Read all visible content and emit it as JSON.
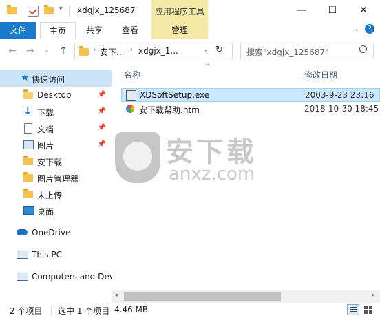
{
  "window": {
    "title": "xdgjx_125687",
    "contextual_tab_label": "应用程序工具",
    "controls": {
      "minimize": "—",
      "maximize": "☐",
      "close": "✕"
    }
  },
  "ribbon": {
    "tabs": [
      {
        "label": "文件"
      },
      {
        "label": "主页"
      },
      {
        "label": "共享"
      },
      {
        "label": "查看"
      },
      {
        "label": "管理"
      }
    ]
  },
  "address": {
    "segments": [
      "安下...",
      "xdgjx_1..."
    ],
    "search_placeholder": "搜索\"xdgjx_125687\""
  },
  "nav": {
    "quick_access": "快速访问",
    "items": [
      {
        "label": "Desktop",
        "icon": "folder-blue-icon",
        "pinned": true
      },
      {
        "label": "下载",
        "icon": "download-icon",
        "pinned": true
      },
      {
        "label": "文档",
        "icon": "document-icon",
        "pinned": true
      },
      {
        "label": "图片",
        "icon": "picture-icon",
        "pinned": true
      },
      {
        "label": "安下载",
        "icon": "folder-icon",
        "pinned": false
      },
      {
        "label": "图片管理器",
        "icon": "folder-icon",
        "pinned": false
      },
      {
        "label": "未上传",
        "icon": "folder-icon",
        "pinned": false
      },
      {
        "label": "桌面",
        "icon": "desktop-icon",
        "pinned": false
      }
    ],
    "onedrive": "OneDrive",
    "thispc": "This PC",
    "network": "Computers and Dev"
  },
  "content": {
    "col_name": "名称",
    "col_date": "修改日期",
    "files": [
      {
        "name": "XDSoftSetup.exe",
        "date": "2003-9-23 23:16",
        "selected": true
      },
      {
        "name": "安下载帮助.htm",
        "date": "2018-10-30 18:45",
        "selected": false
      }
    ]
  },
  "watermark": {
    "title": "安下载",
    "domain": "anxz.com"
  },
  "status": {
    "count": "2 个项目",
    "selected": "选中 1 个项目",
    "size": "4.46 MB"
  },
  "colors": {
    "accent": "#1979ca",
    "context_tab": "#f6e9a8",
    "selection": "#cce8ff"
  }
}
